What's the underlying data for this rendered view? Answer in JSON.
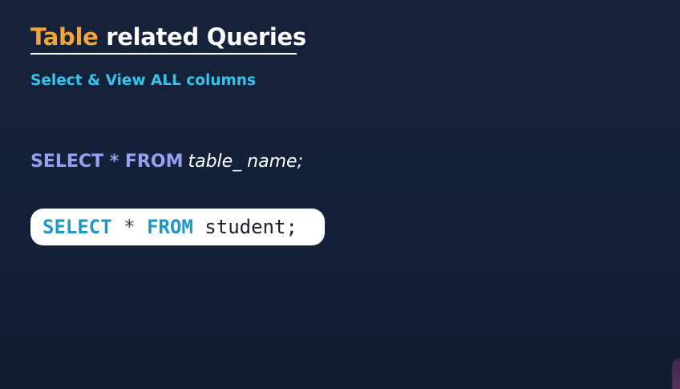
{
  "slide": {
    "title_accent": "Table",
    "title_rest": " related Queries",
    "subtitle": "Select & View ALL columns",
    "syntax": {
      "keywords": "SELECT * FROM",
      "table_placeholder": "table_ name;"
    },
    "example": {
      "kw_select": "SELECT",
      "op_star": " * ",
      "kw_from": "FROM",
      "rest": " student;"
    }
  },
  "colors": {
    "background": "#16233b",
    "title_accent": "#f2a33a",
    "subtitle": "#35c4ea",
    "syntax_keyword": "#9aa0f0",
    "code_keyword": "#1f97c4"
  }
}
